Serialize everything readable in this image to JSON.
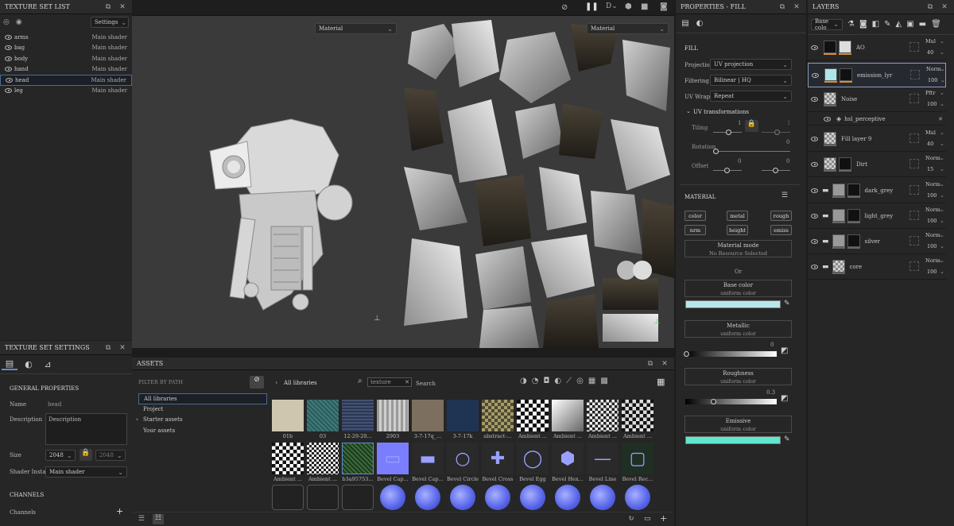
{
  "texture_set_list": {
    "title": "TEXTURE SET LIST",
    "settings_label": "Settings",
    "items": [
      {
        "name": "arms",
        "shader": "Main shader"
      },
      {
        "name": "bag",
        "shader": "Main shader"
      },
      {
        "name": "body",
        "shader": "Main shader"
      },
      {
        "name": "hand",
        "shader": "Main shader"
      },
      {
        "name": "head",
        "shader": "Main shader"
      },
      {
        "name": "leg",
        "shader": "Main shader"
      }
    ]
  },
  "texture_set_settings": {
    "title": "TEXTURE SET SETTINGS",
    "general": "GENERAL PROPERTIES",
    "name_label": "Name",
    "name_value": "head",
    "desc_label": "Description",
    "desc_value": "Description",
    "size_label": "Size",
    "size_value": "2048",
    "size_value2": "2048",
    "shader_label": "Shader Instance",
    "shader_value": "Main shader",
    "channels": "CHANNELS",
    "channels_label": "Channels"
  },
  "viewport": {
    "mode_left": "Material",
    "mode_right": "Material"
  },
  "assets": {
    "title": "ASSETS",
    "filter": "FILTER BY PATH",
    "nav": [
      "All libraries",
      "Project",
      "Starter assets",
      "Your assets"
    ],
    "breadcrumb": "All libraries",
    "search_value": "texture",
    "search_label": "Search",
    "row1": [
      "01b",
      "03",
      "12-29-20...",
      "2903",
      "3-7-17q_...",
      "3-7-17k",
      "abstract-...",
      "Ambient ...",
      "Ambient ...",
      "Ambient ...",
      "Ambient ..."
    ],
    "row2": [
      "Ambient ...",
      "Ambient ...",
      "b3a95753...",
      "Bevel Cap...",
      "Bevel Cap...",
      "Bevel Circle",
      "Bevel Cross",
      "Bevel Egg",
      "Bevel Hex...",
      "Bevel Line",
      "Bevel Rec..."
    ]
  },
  "properties": {
    "title": "PROPERTIES - FILL",
    "fill": "FILL",
    "projection_label": "Projection",
    "projection": "UV projection",
    "filtering_label": "Filtering",
    "filtering": "Bilinear | HQ",
    "uvwrap_label": "UV Wrap",
    "uvwrap": "Repeat",
    "uvtrans": "UV transformations",
    "tiling": "Tiling",
    "tiling_val": "1",
    "rotation": "Rotation",
    "rotation_val": "0",
    "offset": "Offset",
    "offset_val1": "0",
    "offset_val2": "0",
    "tiling_val2": "1",
    "material": "MATERIAL",
    "mat_buttons": [
      "color",
      "metal",
      "rough",
      "nrm",
      "height",
      "emiss"
    ],
    "mat_mode": "Material mode",
    "no_res": "No Resource Selected",
    "or": "Or",
    "base": "Base color",
    "uniform": "uniform color",
    "metallic": "Metallic",
    "metallic_val": "0",
    "roughness": "Roughness",
    "roughness_val": "0.3",
    "emissive": "Emissive",
    "base_color": "#b7e7ea",
    "emissive_color": "#5ee8d0"
  },
  "layers": {
    "title": "LAYERS",
    "channel": "Base colo",
    "items": [
      {
        "name": "AO",
        "blend": "Mul",
        "op": "40"
      },
      {
        "name": "emission_lyr",
        "blend": "Norm",
        "op": "100"
      },
      {
        "name": "Noise",
        "blend": "Pftr",
        "op": "100"
      },
      {
        "name": "hsl_perceptive",
        "blend": "",
        "op": ""
      },
      {
        "name": "Fill layer 9",
        "blend": "Mul",
        "op": "40"
      },
      {
        "name": "Dirt",
        "blend": "Norm",
        "op": "15"
      },
      {
        "name": "dark_grey",
        "blend": "Norm",
        "op": "100"
      },
      {
        "name": "light_grey",
        "blend": "Norm",
        "op": "100"
      },
      {
        "name": "silver",
        "blend": "Norm",
        "op": "100"
      },
      {
        "name": "core",
        "blend": "Norm",
        "op": "100"
      }
    ]
  }
}
